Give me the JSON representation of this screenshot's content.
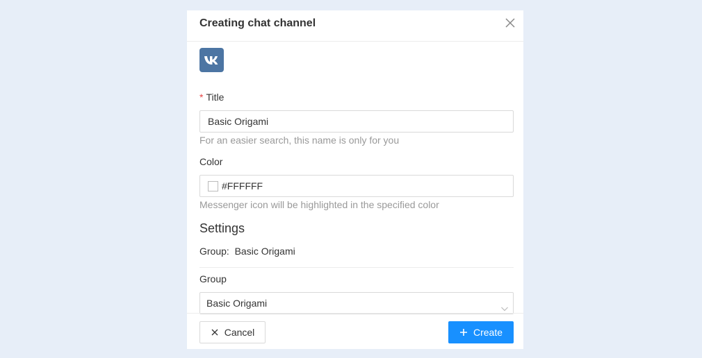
{
  "modal": {
    "title": "Creating chat channel"
  },
  "channel_icon": "vk-logo-icon",
  "title_field": {
    "required_mark": "*",
    "label": "Title",
    "value": "Basic Origami",
    "help": "For an easier search, this name is only for you"
  },
  "color_field": {
    "label": "Color",
    "value": "#FFFFFF",
    "swatch_color": "#FFFFFF",
    "help": "Messenger icon will be highlighted in the specified color"
  },
  "settings": {
    "title": "Settings",
    "group_info_label": "Group:",
    "group_info_value": "Basic Origami",
    "group_select_label": "Group",
    "group_select_value": "Basic Origami"
  },
  "footer": {
    "cancel_label": "Cancel",
    "create_label": "Create"
  },
  "colors": {
    "accent": "#1890ff",
    "vk_brand": "#4c75a3",
    "required": "#e64545",
    "background": "#e7eef8"
  }
}
